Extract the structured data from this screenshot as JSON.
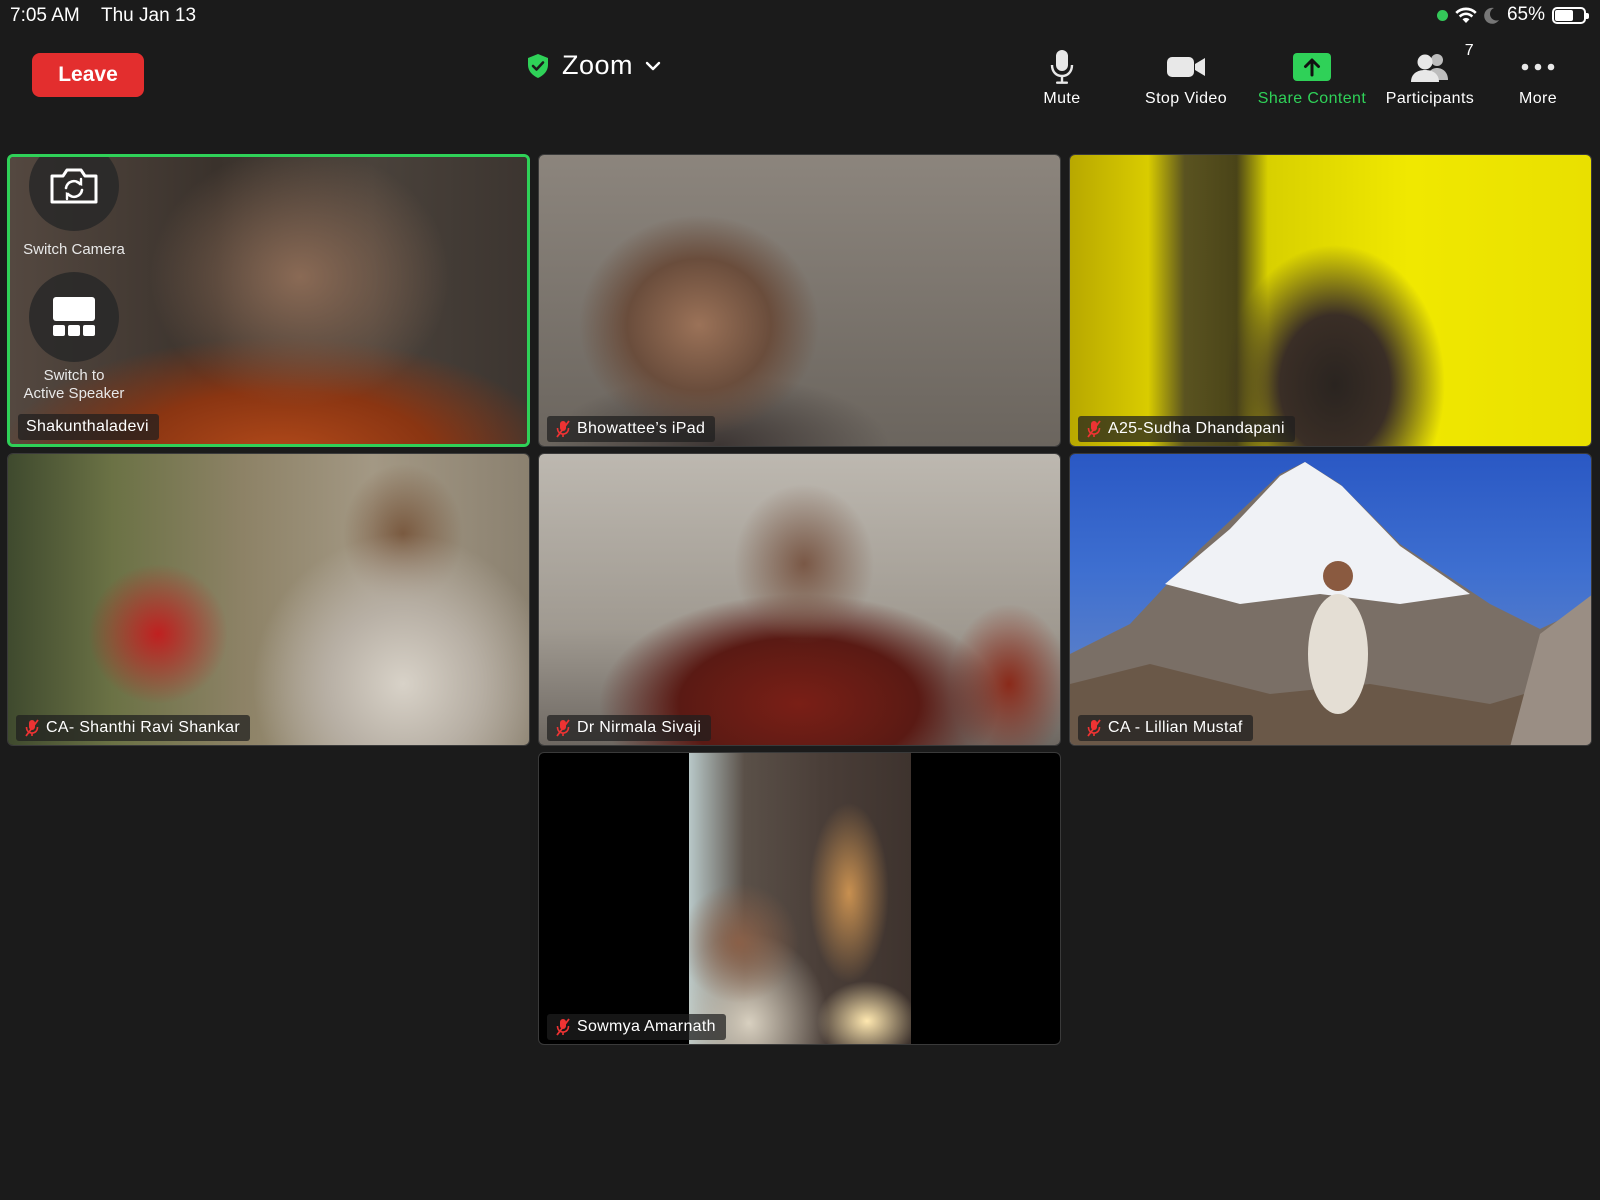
{
  "status_bar": {
    "time": "7:05 AM",
    "date": "Thu Jan 13",
    "battery_percent": "65%",
    "battery_level": 0.65
  },
  "meeting": {
    "leave_label": "Leave",
    "title": "Zoom"
  },
  "toolbar": {
    "mute_label": "Mute",
    "stop_video_label": "Stop Video",
    "share_label": "Share Content",
    "participants_label": "Participants",
    "participants_count": "7",
    "more_label": "More"
  },
  "overlay": {
    "switch_camera_label": "Switch Camera",
    "switch_speaker_label_1": "Switch to",
    "switch_speaker_label_2": "Active Speaker"
  },
  "participants": [
    {
      "name": "Shakunthaladevi",
      "muted": false,
      "active": true
    },
    {
      "name": "Bhowattee’s iPad",
      "muted": true
    },
    {
      "name": "A25-Sudha Dhandapani",
      "muted": true
    },
    {
      "name": "CA- Shanthi Ravi Shankar",
      "muted": true
    },
    {
      "name": "Dr Nirmala Sivaji",
      "muted": true
    },
    {
      "name": "CA - Lillian Mustaf",
      "muted": true
    },
    {
      "name": "Sowmya Amarnath",
      "muted": true
    }
  ],
  "colors": {
    "background": "#1b1b1b",
    "leave": "#e32e2e",
    "accent_green": "#2fd158"
  }
}
